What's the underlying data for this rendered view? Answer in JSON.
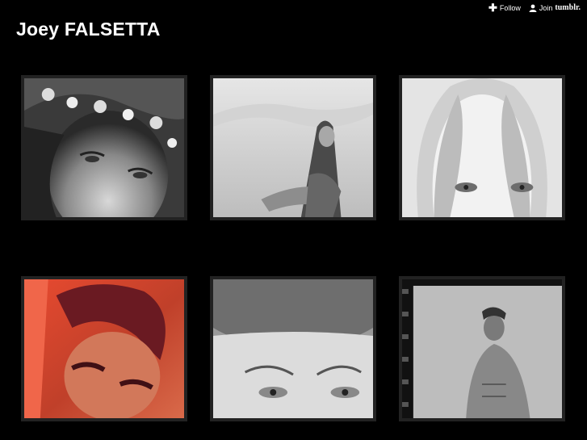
{
  "header": {
    "title": "Joey FALSETTA"
  },
  "topbar": {
    "follow_label": "Follow",
    "join_label": "Join",
    "brand_label": "tumblr."
  },
  "gallery": {
    "items": [
      {
        "description": "woman with flower crown"
      },
      {
        "description": "model with long hair outdoors"
      },
      {
        "description": "blonde woman close-up eyes"
      },
      {
        "description": "red toned portrait"
      },
      {
        "description": "woman eyes close-up"
      },
      {
        "description": "shirtless man on film strip"
      }
    ]
  }
}
